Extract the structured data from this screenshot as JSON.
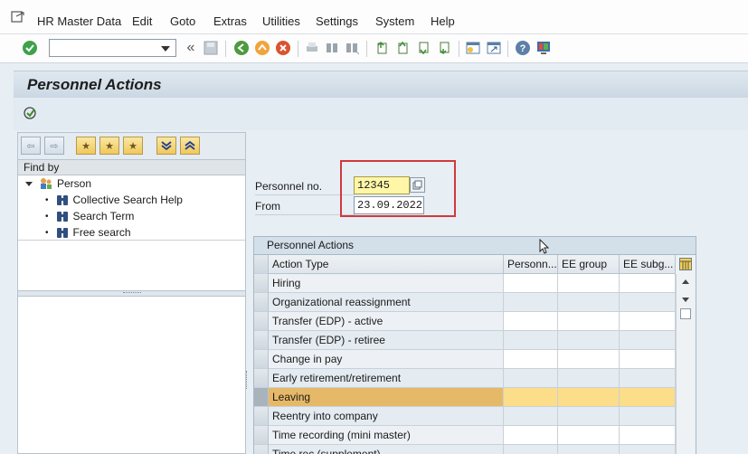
{
  "menu": {
    "items": [
      "HR Master Data",
      "Edit",
      "Goto",
      "Extras",
      "Utilities",
      "Settings",
      "System",
      "Help"
    ]
  },
  "toolbar": {
    "command_field_value": "",
    "icons": [
      "enter-icon",
      "back-icon",
      "exit-icon",
      "cancel-icon",
      "print-icon",
      "find-icon",
      "find-next-icon",
      "first-page-icon",
      "previous-page-icon",
      "next-page-icon",
      "last-page-icon",
      "create-session-icon",
      "create-shortcut-icon",
      "help-icon",
      "customize-layout-icon"
    ]
  },
  "title": "Personnel Actions",
  "left_panel": {
    "find_by_label": "Find by",
    "tree": {
      "root": "Person",
      "children": [
        "Collective Search Help",
        "Search Term",
        "Free search"
      ]
    }
  },
  "form": {
    "personnel_no_label": "Personnel no.",
    "personnel_no_value": "12345",
    "from_label": "From",
    "from_value": "23.09.2022"
  },
  "table": {
    "title": "Personnel Actions",
    "columns": [
      "Action Type",
      "Personn...",
      "EE group",
      "EE subg..."
    ],
    "rows": [
      {
        "action": "Hiring",
        "personnel": "",
        "ee_group": "",
        "ee_subgroup": ""
      },
      {
        "action": "Organizational reassignment",
        "personnel": "",
        "ee_group": "",
        "ee_subgroup": ""
      },
      {
        "action": "Transfer (EDP) - active",
        "personnel": "",
        "ee_group": "",
        "ee_subgroup": ""
      },
      {
        "action": "Transfer (EDP) - retiree",
        "personnel": "",
        "ee_group": "",
        "ee_subgroup": ""
      },
      {
        "action": "Change in pay",
        "personnel": "",
        "ee_group": "",
        "ee_subgroup": ""
      },
      {
        "action": "Early retirement/retirement",
        "personnel": "",
        "ee_group": "",
        "ee_subgroup": ""
      },
      {
        "action": "Leaving",
        "personnel": "",
        "ee_group": "",
        "ee_subgroup": ""
      },
      {
        "action": "Reentry into company",
        "personnel": "",
        "ee_group": "",
        "ee_subgroup": ""
      },
      {
        "action": "Time recording (mini master)",
        "personnel": "",
        "ee_group": "",
        "ee_subgroup": ""
      },
      {
        "action": "Time rec.(supplement)",
        "personnel": "",
        "ee_group": "",
        "ee_subgroup": ""
      }
    ],
    "selected_row": "Leaving"
  },
  "colors": {
    "title_bar": "#cbd8e3",
    "selected_row": "#e6b968",
    "required_field": "#fff6a8",
    "highlight_border": "#d0393c"
  }
}
